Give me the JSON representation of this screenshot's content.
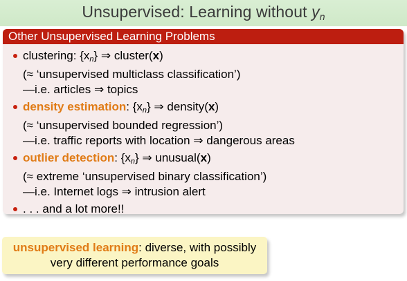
{
  "slide": {
    "title_prefix": "Unsupervised: Learning without",
    "title_var": "y",
    "title_sub": "n"
  },
  "block": {
    "header": "Other Unsupervised Learning Problems",
    "items": [
      {
        "head": "clustering",
        "head_highlight": false,
        "formula_left": "{x",
        "formula_sub": "n",
        "formula_mid": "} ⇒ cluster(",
        "formula_var": "x",
        "formula_end": ")",
        "line2": "(≈ ‘unsupervised multiclass classification’)",
        "line3": "—i.e. articles ⇒ topics"
      },
      {
        "head": "density estimation",
        "head_highlight": true,
        "formula_left": "{x",
        "formula_sub": "n",
        "formula_mid": "} ⇒ density(",
        "formula_var": "x",
        "formula_end": ")",
        "line2": "(≈ ‘unsupervised bounded regression’)",
        "line3": "—i.e. traffic reports with location ⇒ dangerous areas"
      },
      {
        "head": "outlier detection",
        "head_highlight": true,
        "formula_left": "{x",
        "formula_sub": "n",
        "formula_mid": "} ⇒ unusual(",
        "formula_var": "x",
        "formula_end": ")",
        "line2": "(≈ extreme ‘unsupervised binary classification’)",
        "line3": "—i.e. Internet logs ⇒ intrusion alert"
      },
      {
        "text": ". . . and a lot more!!"
      }
    ]
  },
  "callout": {
    "highlight": "unsupervised learning",
    "rest": ": diverse, with possibly",
    "line2": "very different performance goals"
  },
  "colors": {
    "title_bg": "#cfe9c8",
    "header_bg": "#bd1e10",
    "block_bg": "#f6ecec",
    "highlight": "#e07b16",
    "callout_bg": "#fbf5c4"
  }
}
